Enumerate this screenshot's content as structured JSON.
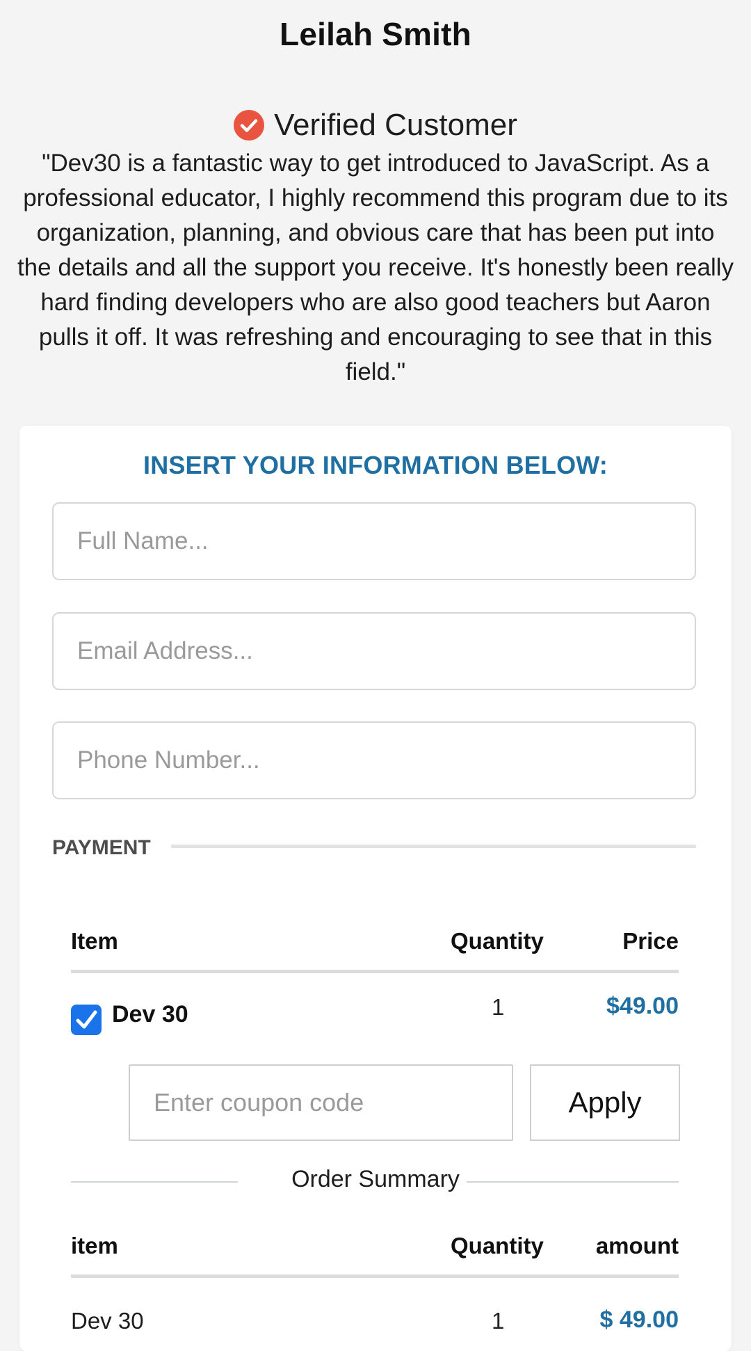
{
  "profile": {
    "name": "Leilah Smith",
    "verified_label": "Verified Customer",
    "quote": "\"Dev30 is a fantastic way to get introduced to JavaScript. As a professional educator, I highly recommend this program due to its organization, planning, and obvious care that has been put into the details and all the support you receive. It's honestly been really hard finding developers who are also good teachers but Aaron pulls it off. It was refreshing and encouraging to see that in this field.\""
  },
  "form": {
    "title": "INSERT YOUR INFORMATION BELOW:",
    "full_name_placeholder": "Full Name...",
    "email_placeholder": "Email Address...",
    "phone_placeholder": "Phone Number...",
    "payment_label": "PAYMENT"
  },
  "payment_table": {
    "headers": [
      "Item",
      "Quantity",
      "Price"
    ],
    "row": {
      "checked": true,
      "item": "Dev 30",
      "quantity": "1",
      "price": "$49.00"
    }
  },
  "coupon": {
    "placeholder": "Enter coupon code",
    "apply_label": "Apply"
  },
  "order_summary": {
    "label": "Order Summary",
    "headers": [
      "item",
      "Quantity",
      "amount"
    ],
    "row": {
      "item": "Dev 30",
      "quantity": "1",
      "amount": "$ 49.00"
    }
  },
  "colors": {
    "accent": "#1f6fa3",
    "check_badge": "#e8543f",
    "checkbox": "#1a73e8"
  },
  "icons": {
    "verified": "check-circle-icon",
    "checkbox": "checkmark-icon"
  }
}
